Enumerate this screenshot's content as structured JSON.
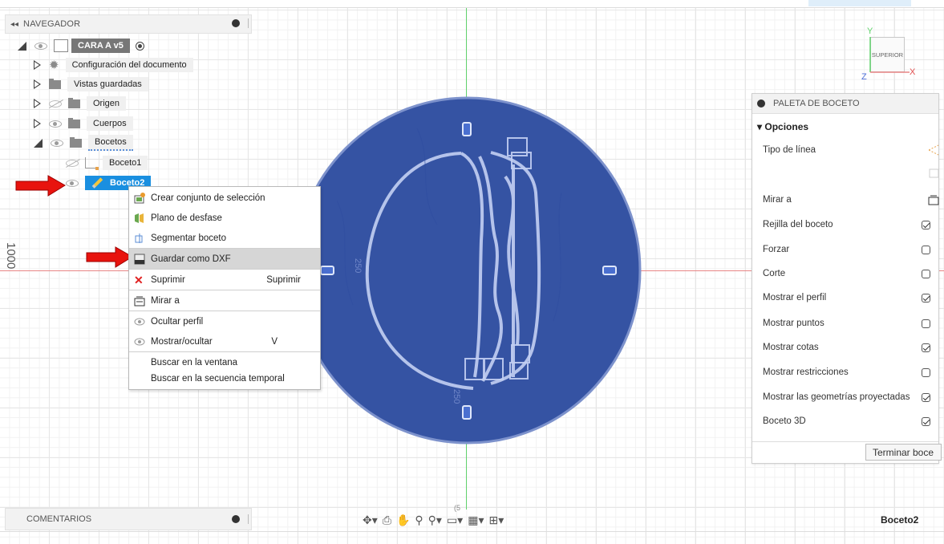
{
  "viewport": {
    "side_label": "1000",
    "dimension_top": "250",
    "dimension_bottom": "250",
    "dimension_small": "(5"
  },
  "view_cube": {
    "face": "SUPERIOR",
    "x": "X",
    "y": "Y",
    "z": "Z"
  },
  "navigator": {
    "title": "NAVEGADOR",
    "component": "CARA A v5",
    "items": [
      {
        "label": "Configuración del documento"
      },
      {
        "label": "Vistas guardadas"
      },
      {
        "label": "Origen"
      },
      {
        "label": "Cuerpos"
      },
      {
        "label": "Bocetos"
      },
      {
        "label": "Boceto1"
      },
      {
        "label": "Boceto2"
      }
    ]
  },
  "context_menu": {
    "items": [
      {
        "label": "Crear conjunto de selección",
        "icon": "selection-set-icon"
      },
      {
        "label": "Plano de desfase",
        "icon": "offset-plane-icon"
      },
      {
        "label": "Segmentar boceto",
        "icon": "slice-icon"
      },
      {
        "label": "Guardar como DXF",
        "icon": "dxf-icon"
      },
      {
        "label": "Suprimir",
        "shortcut": "Suprimir",
        "icon": "delete-icon"
      },
      {
        "label": "Mirar a",
        "icon": "look-at-icon"
      },
      {
        "label": "Ocultar perfil",
        "icon": "eye-icon"
      },
      {
        "label": "Mostrar/ocultar",
        "shortcut": "V",
        "icon": "eye-icon"
      },
      {
        "label": "Buscar en la ventana"
      },
      {
        "label": "Buscar en la secuencia temporal"
      }
    ]
  },
  "sketch_palette": {
    "title": "PALETA DE BOCETO",
    "section": "Opciones",
    "rows": [
      {
        "label": "Tipo de línea",
        "type": "icon"
      },
      {
        "label": "",
        "type": "icon"
      },
      {
        "label": "Mirar a",
        "type": "icon"
      },
      {
        "label": "Rejilla del boceto",
        "checked": true
      },
      {
        "label": "Forzar",
        "checked": false
      },
      {
        "label": "Corte",
        "checked": false
      },
      {
        "label": "Mostrar el perfil",
        "checked": true
      },
      {
        "label": "Mostrar puntos",
        "checked": false
      },
      {
        "label": "Mostrar cotas",
        "checked": true
      },
      {
        "label": "Mostrar restricciones",
        "checked": false
      },
      {
        "label": "Mostrar las geometrías proyectadas",
        "checked": true
      },
      {
        "label": "Boceto 3D",
        "checked": true
      }
    ],
    "finish_button": "Terminar boce"
  },
  "comments": {
    "title": "COMENTARIOS"
  },
  "status": {
    "active_sketch": "Boceto2"
  },
  "colors": {
    "sketch_fill": "#3553a3",
    "sketch_line": "#b9c9f0",
    "selection": "#1a8fe0",
    "arrow": "#e8130e"
  }
}
